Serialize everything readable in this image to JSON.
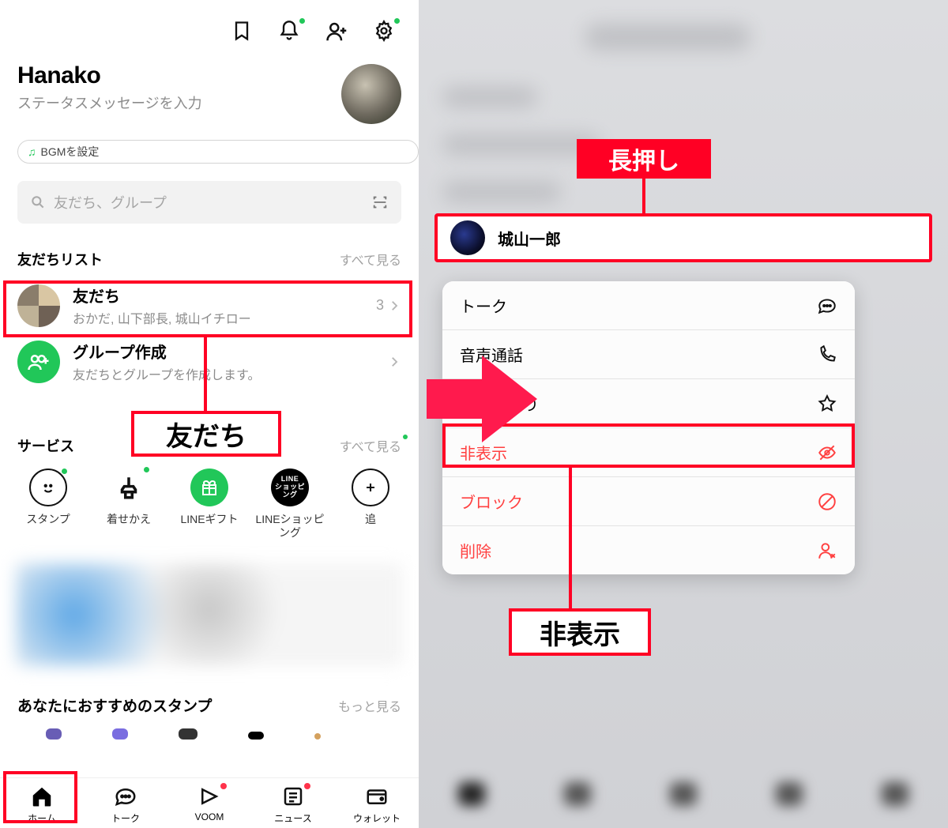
{
  "left": {
    "profile": {
      "name": "Hanako",
      "status": "ステータスメッセージを入力"
    },
    "bgm_label": "BGMを設定",
    "search": {
      "placeholder": "友だち、グループ"
    },
    "friends_section": {
      "title": "友だちリスト",
      "see_all": "すべて見る",
      "friends_row": {
        "title": "友だち",
        "subtitle": "おかだ, 山下部長, 城山イチロー",
        "count": "3"
      },
      "create_group": {
        "title": "グループ作成",
        "subtitle": "友だちとグループを作成します。"
      }
    },
    "services_section": {
      "title": "サービス",
      "see_all": "すべて見る",
      "items": [
        {
          "label": "スタンプ"
        },
        {
          "label": "着せかえ"
        },
        {
          "label": "LINEギフト"
        },
        {
          "label": "LINEショッピング",
          "badge": "LINE\nショッピング"
        },
        {
          "label": "追"
        }
      ]
    },
    "recommend": {
      "title": "あなたにおすすめのスタンプ",
      "more": "もっと見る"
    },
    "tabs": [
      {
        "label": "ホーム"
      },
      {
        "label": "トーク"
      },
      {
        "label": "VOOM"
      },
      {
        "label": "ニュース"
      },
      {
        "label": "ウォレット"
      }
    ]
  },
  "right": {
    "focused_name": "城山一郎",
    "menu": [
      {
        "label": "トーク",
        "icon": "chat",
        "red": false
      },
      {
        "label": "音声通話",
        "icon": "phone",
        "red": false
      },
      {
        "label": "お気に入り",
        "icon": "star",
        "red": false
      },
      {
        "label": "非表示",
        "icon": "eye-off",
        "red": true
      },
      {
        "label": "ブロック",
        "icon": "block",
        "red": true
      },
      {
        "label": "削除",
        "icon": "user-x",
        "red": true
      }
    ]
  },
  "annotations": {
    "friends_label": "友だち",
    "long_press": "長押し",
    "hide_label": "非表示"
  }
}
